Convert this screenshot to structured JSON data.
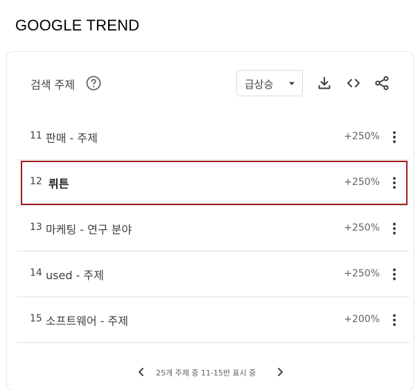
{
  "page": {
    "title": "GOOGLE TREND"
  },
  "card": {
    "header": {
      "title": "검색 주제",
      "help_icon": "help-circle-icon",
      "dropdown": {
        "selected": "급상승",
        "icon": "arrow-drop-down-icon"
      },
      "tools": [
        "download-icon",
        "embed-code-icon",
        "share-icon"
      ]
    },
    "rows": [
      {
        "rank": "11",
        "term": "판매 - 주제",
        "change": "+250%"
      },
      {
        "rank": "12",
        "term": "뤼튼",
        "change": "+250%",
        "highlighted": true
      },
      {
        "rank": "13",
        "term": "마케팅 - 연구 분야",
        "change": "+250%"
      },
      {
        "rank": "14",
        "term": "used - 주제",
        "change": "+250%"
      },
      {
        "rank": "15",
        "term": "소프트웨어 - 주제",
        "change": "+200%"
      }
    ],
    "pagination": {
      "text": "25개 주제 중 11-15번 표시 중",
      "prev_icon": "chevron-left-icon",
      "next_icon": "chevron-right-icon"
    }
  },
  "colors": {
    "highlight_border": "#a01a1f",
    "icon": "#3c4043",
    "divider": "#e0e0e0"
  }
}
